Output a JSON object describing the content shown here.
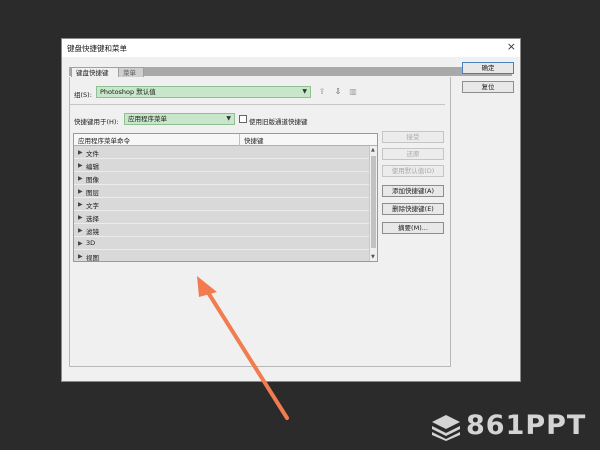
{
  "dialog": {
    "title": "键盘快捷键和菜单",
    "close_icon": "×"
  },
  "tabs": [
    {
      "label": "键盘快捷键",
      "active": true
    },
    {
      "label": "菜单",
      "active": false
    }
  ],
  "group": {
    "label": "组(S):",
    "value": "Photoshop 默认值"
  },
  "shortcuts_for": {
    "label": "快捷键用于(H):",
    "value": "应用程序菜单",
    "legacy_checkbox_label": "使用旧版通道快捷键"
  },
  "table": {
    "headers": [
      "应用程序菜单命令",
      "快捷键"
    ],
    "rows": [
      "文件",
      "编辑",
      "图像",
      "图层",
      "文字",
      "选择",
      "滤镜",
      "3D",
      "视图"
    ]
  },
  "side_buttons": {
    "accept": "接受",
    "undo": "还原",
    "use_default": "使用默认值(D)",
    "add_shortcut": "添加快捷键(A)",
    "delete_shortcut": "删除快捷键(E)",
    "summarize": "摘要(M)..."
  },
  "dialog_buttons": {
    "ok": "确定",
    "reset": "复位"
  },
  "watermark": {
    "text": "861PPT"
  },
  "colors": {
    "accent_select": "#c8e6c9",
    "annotation_arrow": "#f07c4f",
    "background": "#2b2b2b"
  }
}
